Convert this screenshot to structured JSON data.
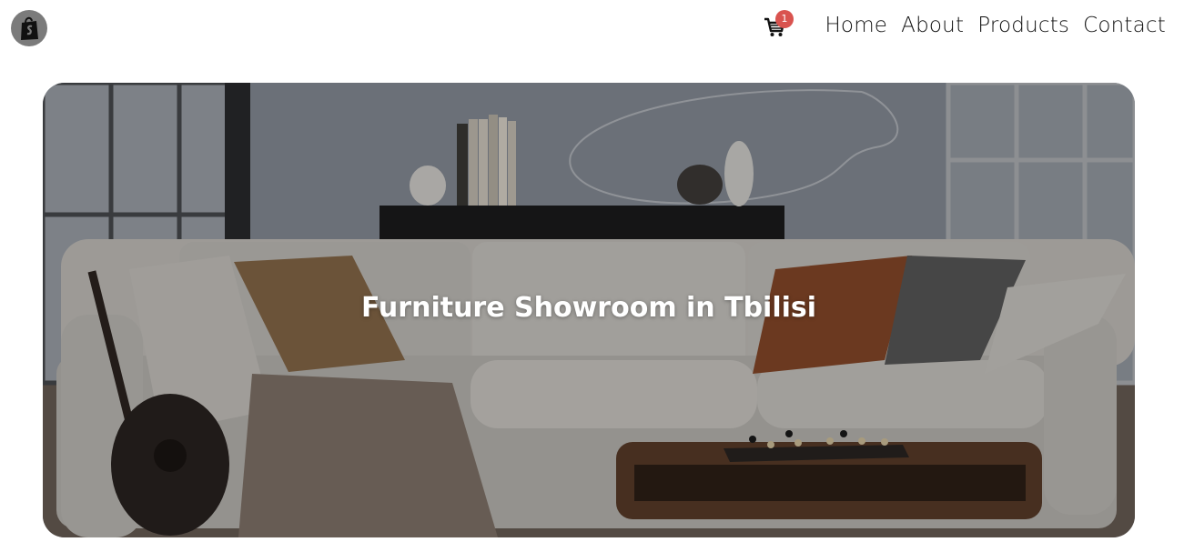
{
  "header": {
    "logo_icon": "shopping-bag-logo-icon",
    "cart": {
      "icon": "cart-icon",
      "count": "1"
    },
    "nav": [
      {
        "label": "Home"
      },
      {
        "label": "About"
      },
      {
        "label": "Products"
      },
      {
        "label": "Contact"
      }
    ]
  },
  "hero": {
    "title": "Furniture Showroom in Tbilisi"
  },
  "colors": {
    "badge": "#d9534f",
    "wall": "#8a909a",
    "sofa": "#c9c6c1"
  }
}
